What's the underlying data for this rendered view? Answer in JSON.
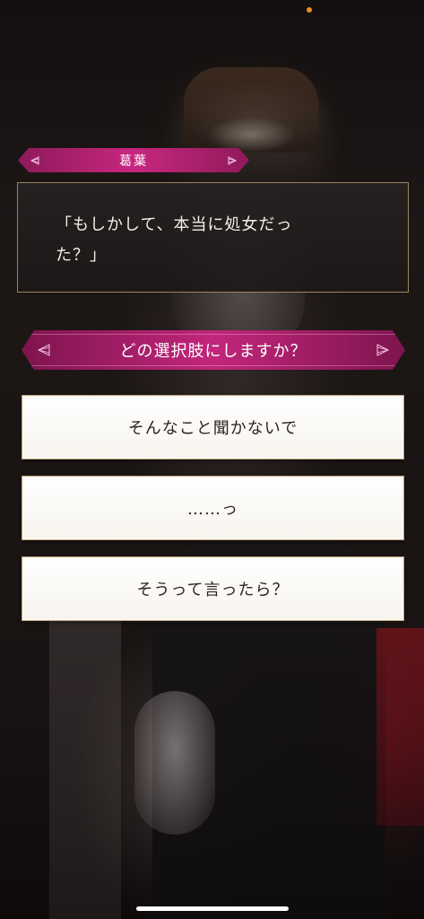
{
  "speaker": {
    "name": "葛葉"
  },
  "dialogue": {
    "text": "「もしかして、本当に処女だっ\nた？」"
  },
  "question": {
    "text": "どの選択肢にしますか？"
  },
  "choices": [
    {
      "label": "そんなこと聞かないで"
    },
    {
      "label": "……っ"
    },
    {
      "label": "そうって言ったら？"
    }
  ],
  "colors": {
    "accent_magenta": "#c2267b",
    "frame_gold": "#9a8560",
    "status_dot": "#f08a24"
  },
  "icons": {
    "plate_ornament": "fan-ornament-icon"
  }
}
